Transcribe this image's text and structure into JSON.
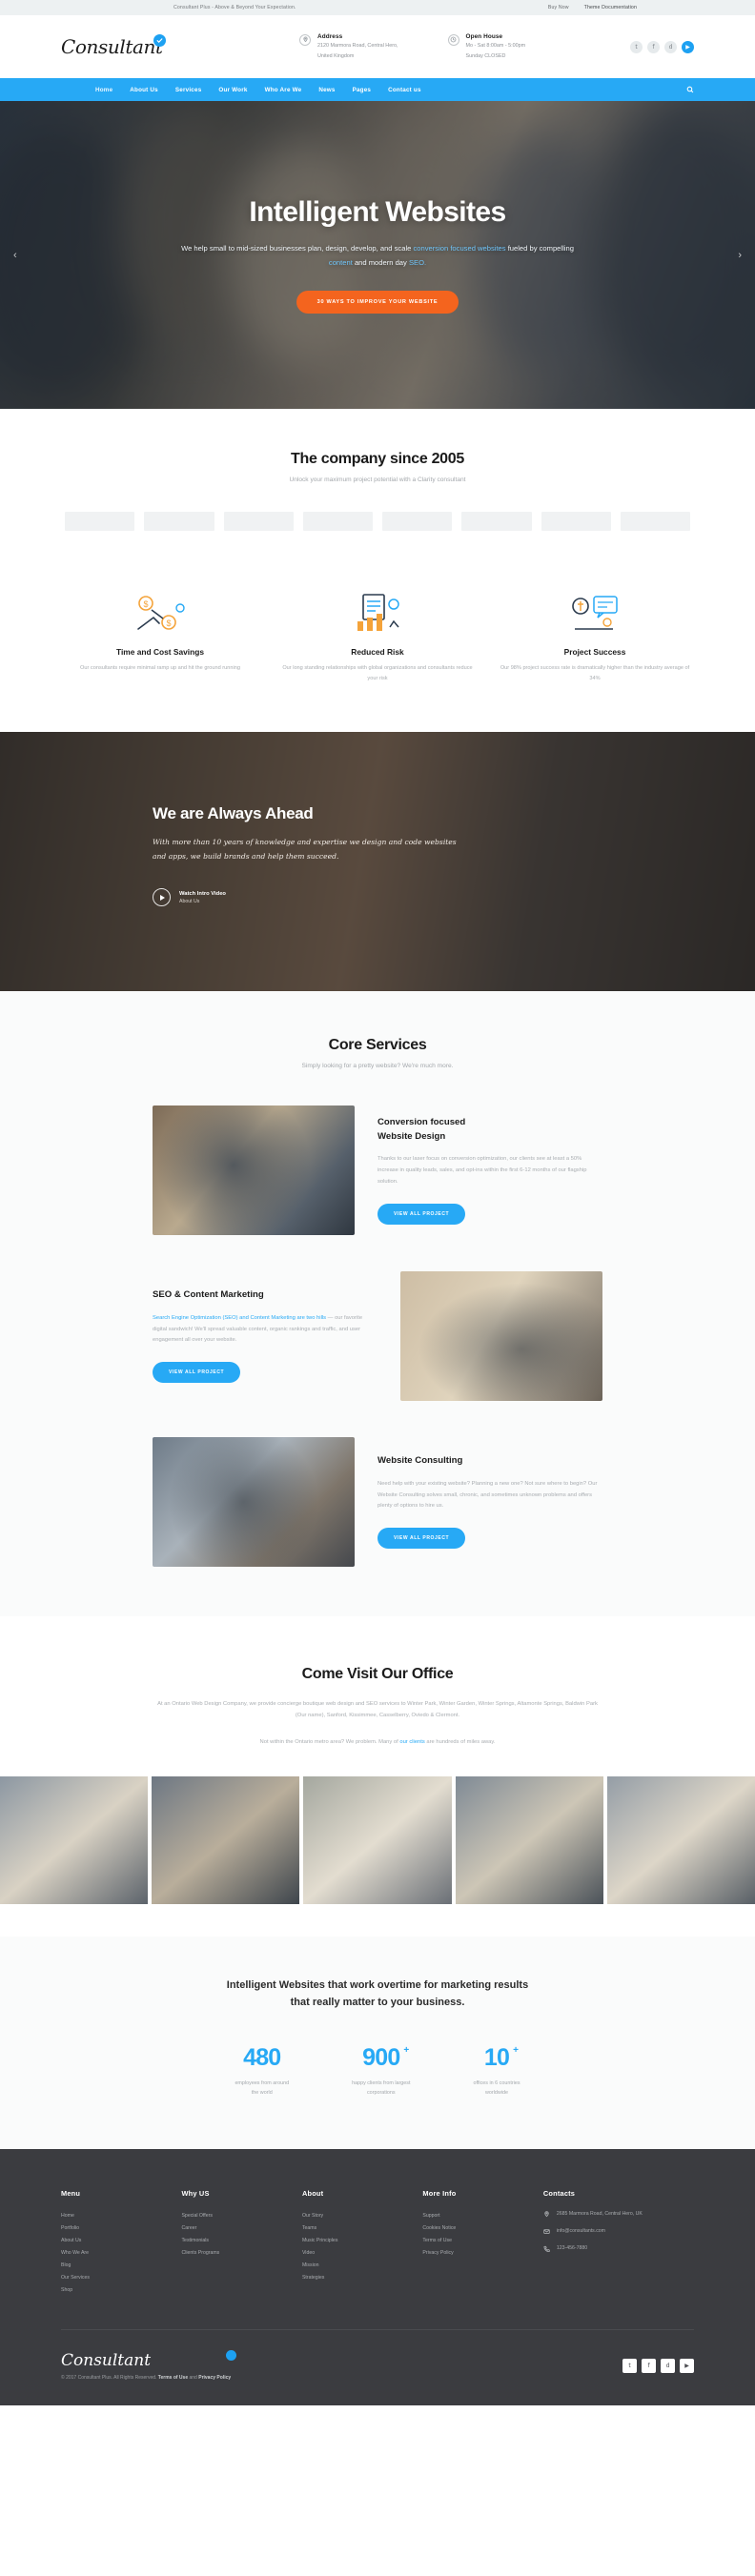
{
  "topbar": {
    "tagline": "Consultant Plus - Above & Beyond Your Expectation.",
    "buy_now": "Buy Now",
    "documentation": "Theme Documentation"
  },
  "header": {
    "logo": "Consultant",
    "address": {
      "title": "Address",
      "line1": "2120 Marmora Road, Central Hero,",
      "line2": "United Kingdom"
    },
    "openhouse": {
      "title": "Open House",
      "line1": "Mo - Sat 8:00am - 5:00pm",
      "line2": "Sunday CLOSED"
    },
    "socials": [
      "twitter-icon",
      "facebook-icon",
      "dribbble-icon",
      "youtube-icon"
    ]
  },
  "nav": {
    "items": [
      {
        "label": "Home",
        "active": true
      },
      {
        "label": "About Us",
        "active": false
      },
      {
        "label": "Services",
        "active": false
      },
      {
        "label": "Our Work",
        "active": false
      },
      {
        "label": "Who Are We",
        "active": false
      },
      {
        "label": "News",
        "active": false
      },
      {
        "label": "Pages",
        "active": false
      },
      {
        "label": "Contact us",
        "active": false
      }
    ],
    "search_icon": "search-icon"
  },
  "hero": {
    "title": "Intelligent Websites",
    "sub_a": "We help small to mid-sized businesses plan, design, develop, and scale ",
    "sub_hl1": "conversion focused websites",
    "sub_b": " fueled by compelling ",
    "sub_hl2": "content",
    "sub_c": " and modern day ",
    "sub_hl3": "SEO.",
    "cta": "30 WAYS TO IMPROVE YOUR WEBSITE",
    "prev_icon": "chevron-left-icon",
    "next_icon": "chevron-right-icon"
  },
  "since": {
    "title": "The company since 2005",
    "subtitle": "Unlock your maximum project potential with a Clarity consultant",
    "logo_count": 8
  },
  "features": [
    {
      "icon": "money-savings-icon",
      "title": "Time and Cost Savings",
      "text": "Our consultants require minimal ramp up and hit the ground running"
    },
    {
      "icon": "risk-chart-icon",
      "title": "Reduced Risk",
      "text": "Our long standing relationships with global organizations and consultants reduce your risk"
    },
    {
      "icon": "project-success-icon",
      "title": "Project Success",
      "text": "Our 98% project success rate is dramatically higher than the industry average of 34%"
    }
  ],
  "ahead": {
    "title": "We are Always Ahead",
    "lede": "With more than 10 years of knowledge and expertise we design and code websites and apps, we build brands and help them succeed.",
    "watch_title": "Watch Intro Video",
    "watch_sub": "About Us",
    "play_icon": "play-icon"
  },
  "core": {
    "title": "Core Services",
    "subtitle": "Simply looking for a pretty website? We're much more.",
    "services": [
      {
        "title": "Conversion focused\nWebsite Design",
        "title_l1": "Conversion focused",
        "title_l2": "Website Design",
        "text": "Thanks to our laser focus on conversion optimization, our clients see at least a 50% increase in quality leads, sales, and opt-ins within the first 6-12 months of our flagship solution.",
        "button": "VIEW ALL PROJECT",
        "image_alt": "man-with-laptop-photo",
        "reversed": false
      },
      {
        "title_l1": "SEO & Content Marketing",
        "title_l2": "",
        "link_text": "Search Engine Optimization (SEO) and Content Marketing are two hills",
        "text": " — our favorite digital sandwich! We'll spread valuable content, organic rankings and traffic, and user engagement all over your website.",
        "button": "VIEW ALL PROJECT",
        "image_alt": "desk-workspace-photo",
        "reversed": true
      },
      {
        "title_l1": "Website Consulting",
        "title_l2": "",
        "text": "Need help with your existing website? Planning a new one? Not sure where to begin? Our Website Consulting solves small, chronic, and sometimes unknown problems and offers plenty of options to hire us.",
        "button": "VIEW ALL PROJECT",
        "image_alt": "man-reading-photo",
        "reversed": false
      }
    ]
  },
  "office": {
    "title": "Come Visit Our Office",
    "body_a": "At an Ontario Web Design Company, we provide concierge boutique web design and SEO services to Winter Park, Winter Garden, Winter Springs, Altamonte Springs, Baldwin Park (Our name), Sanford, Kissimmee, Casselberry, Oviedo & Clermont.",
    "body_b": "Not within the Ontario metro area? We problem. Many of ",
    "body_link": "our clients",
    "body_c": " are hundreds of miles away.",
    "gallery_count": 5
  },
  "stats": {
    "headline_l1": "Intelligent Websites that work overtime for marketing results",
    "headline_l2": "that really matter to your business.",
    "items": [
      {
        "number": "480",
        "plus": "",
        "label_l1": "employees from around",
        "label_l2": "the world"
      },
      {
        "number": "900",
        "plus": "+",
        "label_l1": "happy clients from largest",
        "label_l2": "corporations"
      },
      {
        "number": "10",
        "plus": "+",
        "label_l1": "offices in 6 countries",
        "label_l2": "worldwide"
      }
    ]
  },
  "footer": {
    "columns": [
      {
        "heading": "Menu",
        "links": [
          "Home",
          "Portfolio",
          "About Us",
          "Who We Are",
          "Blog",
          "Our Services",
          "Shop"
        ]
      },
      {
        "heading": "Why US",
        "links": [
          "Special Offers",
          "Career",
          "Testimonials",
          "Clients Programs"
        ]
      },
      {
        "heading": "About",
        "links": [
          "Our Story",
          "Teams",
          "Music Principles",
          "Video",
          "Mission",
          "Strategies"
        ]
      },
      {
        "heading": "More Info",
        "links": [
          "Support",
          "Cookies Notice",
          "Terms of Use",
          "Privacy Policy"
        ]
      }
    ],
    "contacts": {
      "heading": "Contacts",
      "address": "2685 Marmora Road,\nCentral Hero, UK",
      "email": "info@consultants.com",
      "phone": "123-456-7880",
      "address_icon": "map-pin-icon",
      "email_icon": "envelope-icon",
      "phone_icon": "phone-icon"
    },
    "logo": "Consultant",
    "copyright_a": "© 2017  Consultant Plus. All Rights Reserved. ",
    "copyright_terms": "Terms of Use",
    "copyright_and": " and ",
    "copyright_privacy": "Privacy Policy",
    "socials": [
      "twitter-icon",
      "facebook-icon",
      "dribbble-icon",
      "youtube-icon"
    ]
  },
  "colors": {
    "brand_blue": "#27a9f5",
    "accent_orange": "#f4641e",
    "footer_bg": "#3b3c40",
    "topbar_bg": "#edf1f2"
  }
}
